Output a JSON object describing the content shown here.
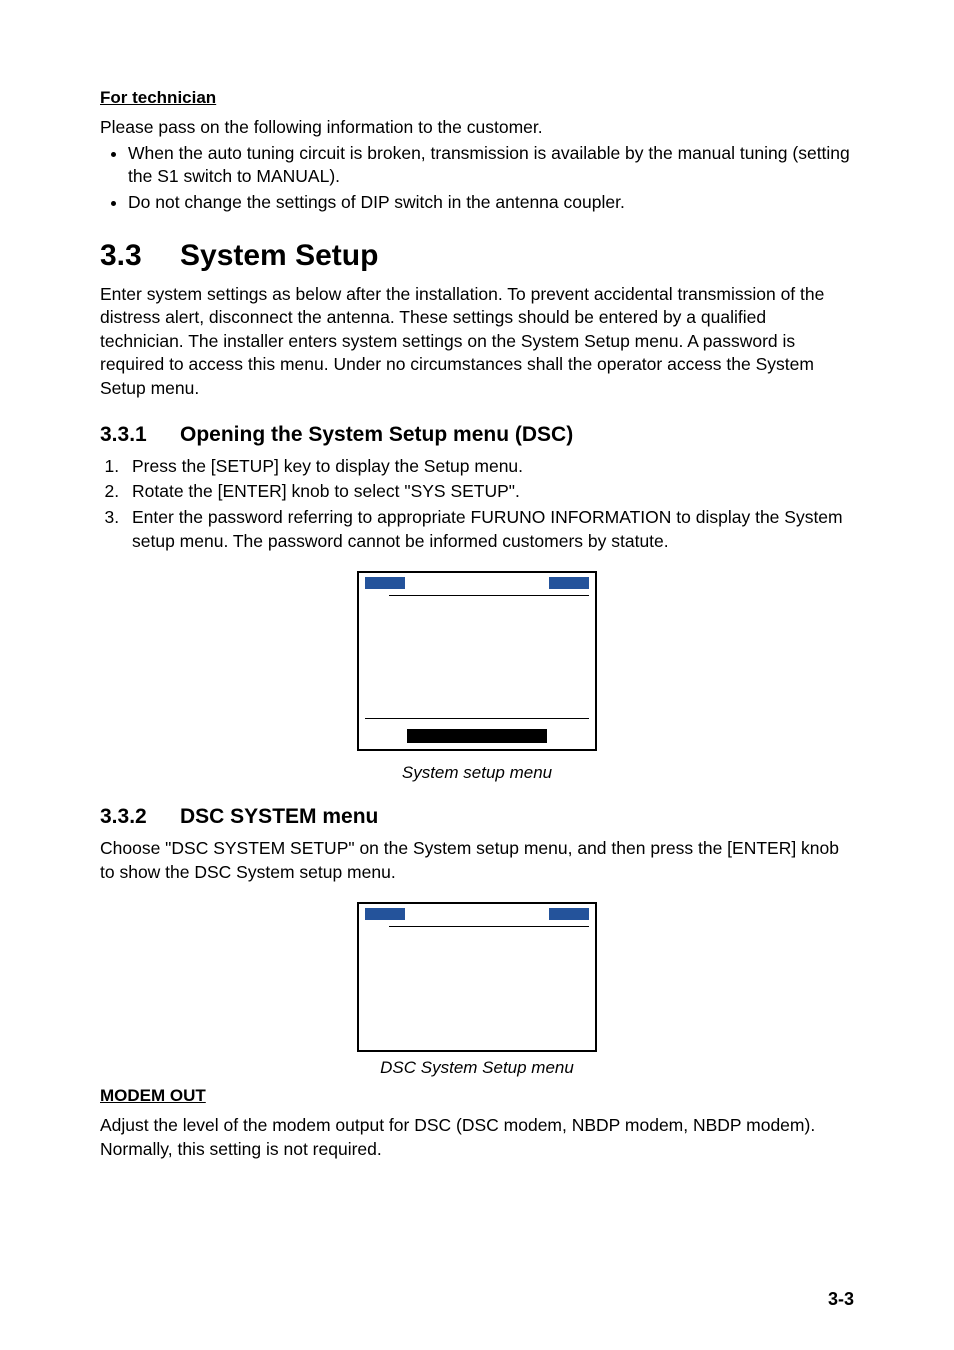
{
  "headings": {
    "for_technician": "For technician",
    "modem_out": "MODEM OUT"
  },
  "tech_intro": "Please pass on the following information to the customer.",
  "tech_bullets": [
    "When the auto tuning circuit is broken, transmission is available by the manual tuning (setting the S1 switch to MANUAL).",
    "Do not change the settings of DIP switch in the antenna coupler."
  ],
  "section": {
    "num": "3.3",
    "title": "System Setup",
    "intro": "Enter system settings as below after the installation. To prevent accidental transmission of the distress alert, disconnect the antenna. These settings should be entered by a qualified technician. The installer enters system settings on the System Setup menu. A password is required to access this menu. Under no circumstances shall the operator access the System Setup menu."
  },
  "sub1": {
    "num": "3.3.1",
    "title": "Opening the System Setup menu (DSC)",
    "steps": [
      "Press the [SETUP] key to display the Setup menu.",
      "Rotate the [ENTER] knob to select \"SYS SETUP\".",
      "Enter the password referring to appropriate FURUNO INFORMATION to display the System setup menu. The password cannot be informed customers by statute."
    ],
    "caption": "System setup menu"
  },
  "sub2": {
    "num": "3.3.2",
    "title": "DSC SYSTEM menu",
    "intro": "Choose \"DSC SYSTEM SETUP\" on the System setup menu, and then press the [ENTER] knob to show the DSC System setup menu.",
    "caption": "DSC System Setup menu"
  },
  "modem_out_para": "Adjust the level of the modem output for DSC (DSC modem, NBDP modem, NBDP modem). Normally, this setting is not required.",
  "page_number": "3-3"
}
